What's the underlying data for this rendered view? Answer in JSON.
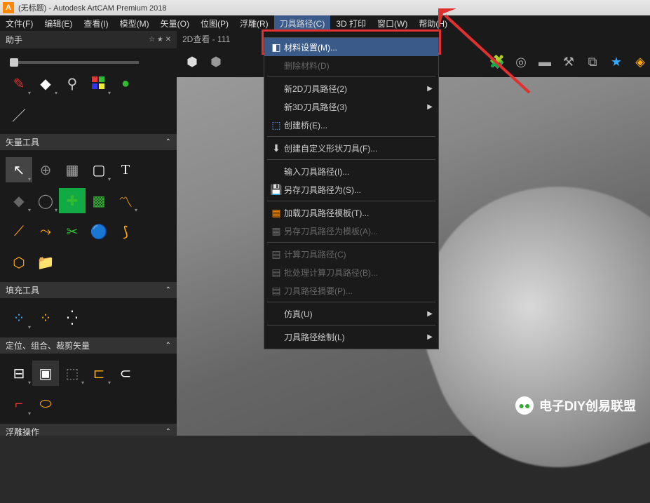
{
  "title": "(无标题) - Autodesk ArtCAM Premium 2018",
  "logo": "A",
  "menu": [
    "文件(F)",
    "编辑(E)",
    "查看(I)",
    "模型(M)",
    "矢量(O)",
    "位图(P)",
    "浮雕(R)",
    "刀具路径(C)",
    "3D 打印",
    "窗口(W)",
    "帮助(H)"
  ],
  "menu_active_index": 7,
  "sidebar": {
    "title": "助手",
    "sections": {
      "vector": "矢量工具",
      "fill": "填充工具",
      "position": "定位、组合、裁剪矢量",
      "relief": "浮雕操作"
    }
  },
  "tab": "2D查看 - 111",
  "dropdown": [
    {
      "icon": "◧",
      "label": "材料设置(M)...",
      "hl": true
    },
    {
      "icon": "",
      "label": "删除材料(D)",
      "disabled": true
    },
    {
      "sep": true
    },
    {
      "icon": "",
      "label": "新2D刀具路径(2)",
      "sub": true
    },
    {
      "icon": "",
      "label": "新3D刀具路径(3)",
      "sub": true
    },
    {
      "icon": "⬚",
      "label": "创建桥(E)...",
      "iconColor": "#5af"
    },
    {
      "sep": true
    },
    {
      "icon": "⬇",
      "label": "创建自定义形状刀具(F)..."
    },
    {
      "sep": true
    },
    {
      "icon": "",
      "label": "输入刀具路径(I)..."
    },
    {
      "icon": "💾",
      "label": "另存刀具路径为(S)..."
    },
    {
      "sep": true
    },
    {
      "icon": "▦",
      "label": "加载刀具路径模板(T)...",
      "iconColor": "#f80"
    },
    {
      "icon": "▦",
      "label": "另存刀具路径为模板(A)...",
      "disabled": true
    },
    {
      "sep": true
    },
    {
      "icon": "▤",
      "label": "计算刀具路径(C)",
      "disabled": true
    },
    {
      "icon": "▤",
      "label": "批处理计算刀具路径(B)...",
      "disabled": true
    },
    {
      "icon": "▤",
      "label": "刀具路径摘要(P)...",
      "disabled": true
    },
    {
      "sep": true
    },
    {
      "icon": "",
      "label": "仿真(U)",
      "sub": true
    },
    {
      "sep": true
    },
    {
      "icon": "",
      "label": "刀具路径绘制(L)",
      "sub": true
    }
  ],
  "watermark": "电子DIY创易联盟"
}
